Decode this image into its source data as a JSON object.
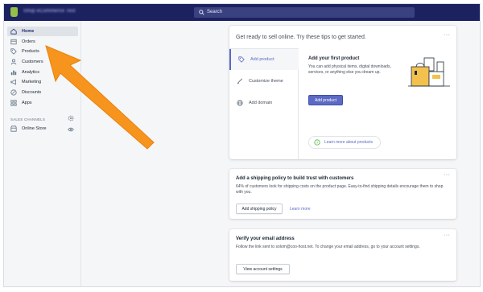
{
  "topbar": {
    "store_name": "Shop eCommerce Test",
    "search_label": "Search"
  },
  "sidebar": {
    "items": [
      {
        "label": "Home",
        "icon": "home-icon",
        "active": true
      },
      {
        "label": "Orders",
        "icon": "orders-icon",
        "active": false
      },
      {
        "label": "Products",
        "icon": "tag-icon",
        "active": false
      },
      {
        "label": "Customers",
        "icon": "person-icon",
        "active": false
      },
      {
        "label": "Analytics",
        "icon": "bar-chart-icon",
        "active": false
      },
      {
        "label": "Marketing",
        "icon": "megaphone-icon",
        "active": false
      },
      {
        "label": "Discounts",
        "icon": "discount-icon",
        "active": false
      },
      {
        "label": "Apps",
        "icon": "apps-grid-icon",
        "active": false
      }
    ],
    "sales_channels_label": "SALES CHANNELS",
    "channels": [
      {
        "label": "Online Store",
        "icon": "store-icon"
      }
    ]
  },
  "tips_card": {
    "title": "Get ready to sell online. Try these tips to get started.",
    "more": "···",
    "tabs": [
      {
        "label": "Add product",
        "icon": "tag-icon",
        "active": true
      },
      {
        "label": "Customize theme",
        "icon": "brush-icon",
        "active": false
      },
      {
        "label": "Add domain",
        "icon": "globe-icon",
        "active": false
      }
    ],
    "panel_title": "Add your first product",
    "panel_text": "You can add physical items, digital downloads, services, or anything else you dream up.",
    "primary_button": "Add product",
    "learn_more": "Learn more about products"
  },
  "shipping_card": {
    "title": "Add a shipping policy to build trust with customers",
    "text": "64% of customers look for shipping costs on the product page. Easy-to-find shipping details encourage them to shop with you.",
    "button": "Add shipping policy",
    "link": "Learn more",
    "more": "···"
  },
  "verify_card": {
    "title": "Verify your email address",
    "text": "Follow the link sent to solom@coo-host.net. To change your email address, go to your account settings.",
    "button": "View account settings",
    "more": "···"
  },
  "colors": {
    "topbar": "#1c2260",
    "accent": "#5c6ac4",
    "arrow": "#f7941d",
    "logo": "#95bf47"
  }
}
